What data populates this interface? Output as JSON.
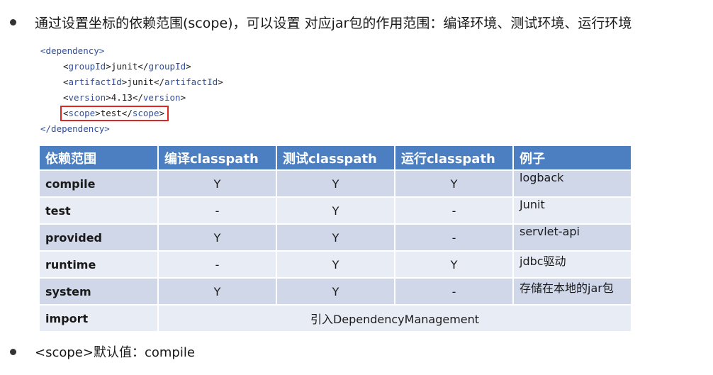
{
  "intro_text": "通过设置坐标的依赖范围(scope)，可以设置 对应jar包的作用范围：编译环境、测试环境、运行环境",
  "code": {
    "dependency_open": "<dependency>",
    "groupId": "<groupId>junit</groupId>",
    "artifactId": "<artifactId>junit</artifactId>",
    "version": "<version>4.13</version>",
    "scope": "<scope>test</scope>",
    "dependency_close": "</dependency>"
  },
  "table": {
    "headers": [
      "依赖范围",
      "编译classpath",
      "测试classpath",
      "运行classpath",
      "例子"
    ],
    "rows": [
      {
        "scope": "compile",
        "compile": "Y",
        "test": "Y",
        "runtime": "Y",
        "example": "logback"
      },
      {
        "scope": "test",
        "compile": "-",
        "test": "Y",
        "runtime": "-",
        "example": "Junit"
      },
      {
        "scope": "provided",
        "compile": "Y",
        "test": "Y",
        "runtime": "-",
        "example": "servlet-api"
      },
      {
        "scope": "runtime",
        "compile": "-",
        "test": "Y",
        "runtime": "Y",
        "example": "jdbc驱动"
      },
      {
        "scope": "system",
        "compile": "Y",
        "test": "Y",
        "runtime": "-",
        "example": "存储在本地的jar包"
      }
    ],
    "import_row": {
      "scope": "import",
      "merged": "引入DependencyManagement"
    }
  },
  "default_text": "<scope>默认值：compile",
  "colors": {
    "header_bg": "#4b7fc1",
    "row_dark": "#cfd7e8",
    "row_light": "#e8ecf4",
    "tag_blue": "#2e4fa3",
    "highlight_red": "#e02525"
  }
}
